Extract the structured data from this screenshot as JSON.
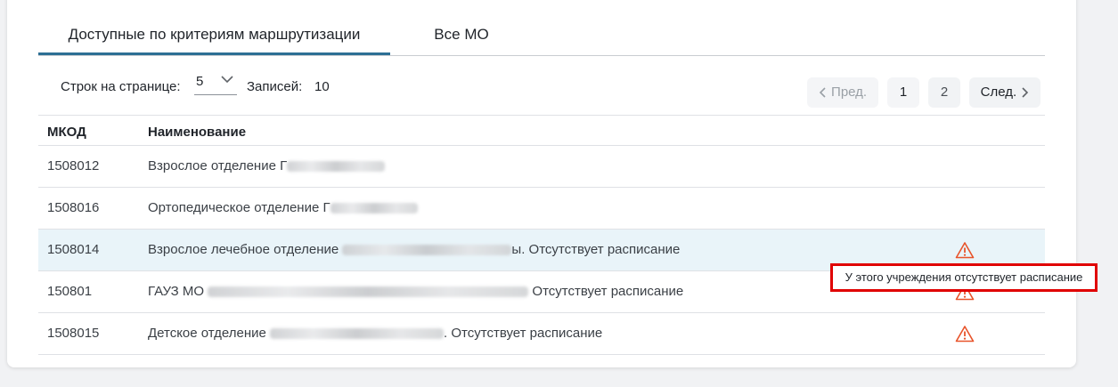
{
  "tabs": [
    {
      "label": "Доступные по критериям маршрутизации",
      "active": true
    },
    {
      "label": "Все МО",
      "active": false
    }
  ],
  "toolbar": {
    "rows_label": "Строк на странице:",
    "rows_value": "5",
    "records_label": "Записей:",
    "records_count": "10"
  },
  "pager": {
    "prev_label": "Пред.",
    "page1": "1",
    "page2": "2",
    "next_label": "След."
  },
  "table": {
    "columns": [
      "МКОД",
      "Наименование"
    ],
    "rows": [
      {
        "code": "1508012",
        "name_start": "Взрослое отделение Г",
        "name_end": "",
        "warning": false
      },
      {
        "code": "1508016",
        "name_start": "Ортопедическое отделение Г",
        "name_end": "",
        "warning": false
      },
      {
        "code": "1508014",
        "name_start": "Взрослое лечебное отделение",
        "name_end": "ы. Отсутствует расписание",
        "warning": true
      },
      {
        "code": "150801",
        "name_start": "ГАУЗ МО",
        "name_end": " Отсутствует расписание",
        "warning": true
      },
      {
        "code": "1508015",
        "name_start": "Детское отделение",
        "name_end": ". Отсутствует расписание",
        "warning": true
      }
    ]
  },
  "tooltip": {
    "text": "У этого учреждения отсутствует расписание"
  },
  "colors": {
    "accent": "#2d6f94",
    "warning": "#e8542b",
    "highlight_row": "#e9f4f9",
    "tooltip_border": "#e00000"
  },
  "icons": {
    "warning": "warning-triangle-icon",
    "select": "chevron-down-icon",
    "prev": "chevron-left-icon",
    "next": "chevron-right-icon"
  }
}
